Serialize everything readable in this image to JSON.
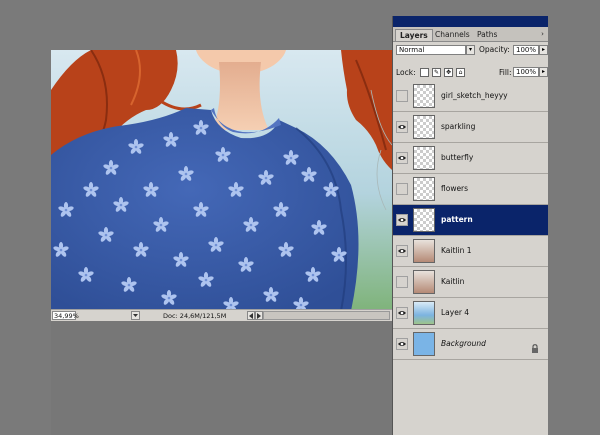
{
  "status": {
    "zoom": "34,99%",
    "doc_size": "Doc: 24,6M/121,5M"
  },
  "panel": {
    "tabs": [
      "Layers",
      "Channels",
      "Paths"
    ],
    "tab_menu_glyph": "›",
    "blend_mode": "Normal",
    "opacity_label": "Opacity:",
    "opacity_value": "100%",
    "lock_label": "Lock:",
    "fill_label": "Fill:",
    "fill_value": "100%"
  },
  "layers": [
    {
      "name": "girl_sketch_heyyy",
      "visible": false,
      "thumb": "checker",
      "selected": false
    },
    {
      "name": "sparkling",
      "visible": true,
      "thumb": "checker",
      "selected": false
    },
    {
      "name": "butterfly",
      "visible": true,
      "thumb": "checker",
      "selected": false
    },
    {
      "name": "flowers",
      "visible": false,
      "thumb": "checker",
      "selected": false
    },
    {
      "name": "pattern",
      "visible": true,
      "thumb": "checker",
      "selected": true
    },
    {
      "name": "Kaitlin  1",
      "visible": true,
      "thumb": "photo",
      "selected": false
    },
    {
      "name": "Kaitlin",
      "visible": false,
      "thumb": "photo",
      "selected": false
    },
    {
      "name": "Layer 4",
      "visible": true,
      "thumb": "sky",
      "selected": false
    },
    {
      "name": "Background",
      "visible": true,
      "thumb": "blue",
      "selected": false,
      "locked": true
    }
  ],
  "colors": {
    "sweater": "#3b5ca8",
    "flower": "#aec4ef",
    "hair": "#b8421a",
    "skin": "#f4c9ab",
    "selection": "#0a246a"
  }
}
